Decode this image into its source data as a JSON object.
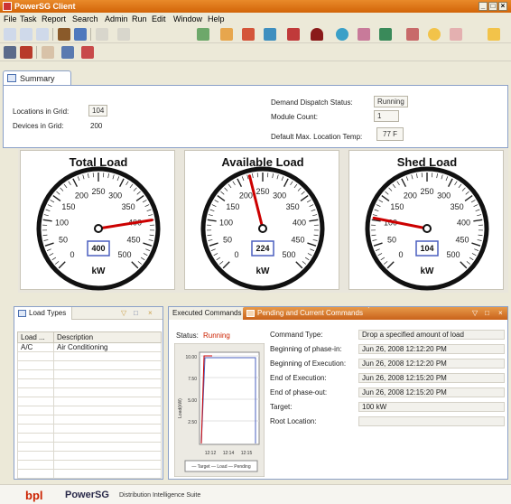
{
  "window": {
    "title": "PowerSG Client"
  },
  "menu": [
    "File",
    "Task",
    "Report",
    "Search",
    "Admin",
    "Run",
    "Edit",
    "Window",
    "Help"
  ],
  "tabs": {
    "summary": "Summary"
  },
  "summary": {
    "locations_label": "Locations in Grid:",
    "locations_value": "104",
    "devices_label": "Devices in Grid:",
    "devices_value": "200",
    "dispatch_label": "Demand Dispatch Status:",
    "dispatch_value": "Running",
    "module_label": "Module Count:",
    "module_value": "1",
    "temp_label": "Default Max. Location Temp:",
    "temp_value": "77 F"
  },
  "gauges": [
    {
      "title": "Total Load",
      "value": 400,
      "readout": "400",
      "unit": "kW"
    },
    {
      "title": "Available Load",
      "value": 224,
      "readout": "224",
      "unit": "kW"
    },
    {
      "title": "Shed Load",
      "value": 104,
      "readout": "104",
      "unit": "kW"
    }
  ],
  "gauge_ticks": [
    "0",
    "50",
    "100",
    "150",
    "200",
    "250",
    "300",
    "350",
    "400",
    "450",
    "500"
  ],
  "load_types": {
    "tab": "Load Types",
    "columns": [
      "Load ...",
      "Description"
    ],
    "rows": [
      {
        "load": "A/C",
        "description": "Air Conditioning"
      }
    ]
  },
  "commands": {
    "tab_executed": "Executed Commands",
    "tab_pending": "Pending and Current Commands",
    "status_label": "Status:",
    "status_value": "Running",
    "fields": [
      {
        "label": "Command Type:",
        "value": "Drop a specified amount of load"
      },
      {
        "label": "Beginning of phase-in:",
        "value": "Jun 26, 2008 12:12:20 PM"
      },
      {
        "label": "Beginning of Execution:",
        "value": "Jun 26, 2008 12:12:20 PM"
      },
      {
        "label": "End of Execution:",
        "value": "Jun 26, 2008 12:15:20 PM"
      },
      {
        "label": "End of phase-out:",
        "value": "Jun 26, 2008 12:15:20 PM"
      },
      {
        "label": "Target:",
        "value": "100 kW"
      },
      {
        "label": "Root Location:",
        "value": ""
      }
    ],
    "mini_chart": {
      "y_ticks": [
        "10.00",
        "7.50",
        "5.00",
        "2.50"
      ],
      "ylabel": "Load(kW)",
      "x_ticks": [
        "12:12",
        "12:14",
        "12:15"
      ],
      "legend": "— Target  — Load  — Pending"
    }
  },
  "footer": {
    "brand": "bpl",
    "product": "PowerSG",
    "tagline": "Distribution Intelligence Suite"
  },
  "colors": {
    "title_orange": "#d26408",
    "needle": "#cc0000",
    "accent_blue": "#4a5fbf",
    "status_red": "#cc2200"
  }
}
